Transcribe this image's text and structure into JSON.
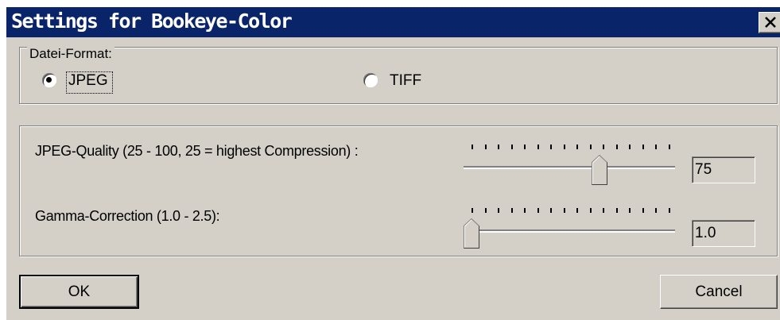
{
  "window": {
    "title": "Settings for Bookeye-Color",
    "close_glyph": "X"
  },
  "format_group": {
    "legend": "Datei-Format:",
    "options": [
      {
        "label": "JPEG",
        "selected": true
      },
      {
        "label": "TIFF",
        "selected": false
      }
    ]
  },
  "quality": {
    "label": "JPEG-Quality (25 - 100, 25 = highest Compression) :",
    "min": 25,
    "max": 100,
    "value": 75,
    "value_text": "75"
  },
  "gamma": {
    "label": "Gamma-Correction (1.0 - 2.5):",
    "min": 1.0,
    "max": 2.5,
    "value": 1.0,
    "value_text": "1.0"
  },
  "buttons": {
    "ok": "OK",
    "cancel": "Cancel"
  },
  "colors": {
    "titlebar": "#0a246a",
    "face": "#d4d0c8",
    "shadow": "#808080",
    "highlight": "#ffffff"
  }
}
